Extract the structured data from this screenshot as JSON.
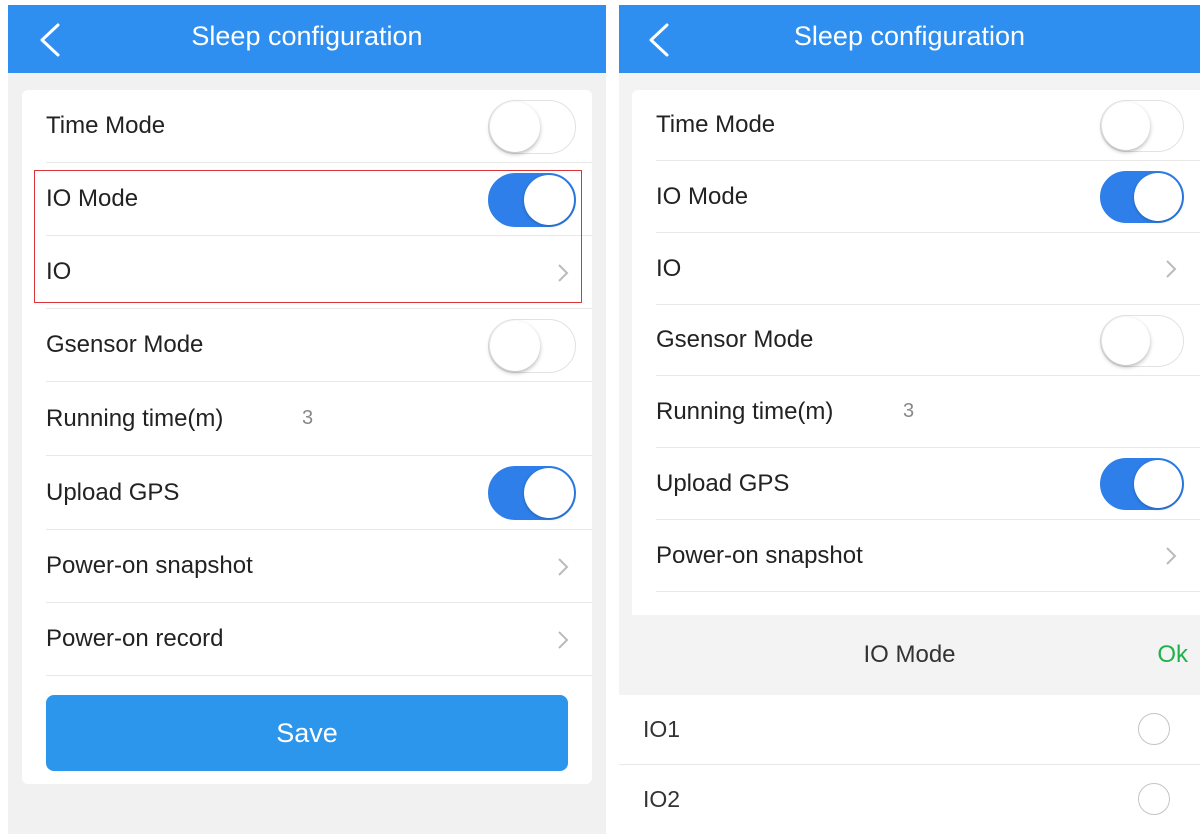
{
  "left_screen": {
    "header": {
      "title": "Sleep configuration"
    },
    "rows": [
      {
        "label": "Time Mode",
        "state": "off"
      },
      {
        "label": "IO Mode",
        "state": "on"
      },
      {
        "label": "IO"
      },
      {
        "label": "Gsensor Mode",
        "state": "off"
      },
      {
        "label": "Running time(m)",
        "value": "3"
      },
      {
        "label": "Upload GPS",
        "state": "on"
      },
      {
        "label": "Power-on snapshot"
      },
      {
        "label": "Power-on record"
      }
    ],
    "save_label": "Save",
    "highlight_color": "#d9343a"
  },
  "right_screen": {
    "header": {
      "title": "Sleep configuration"
    },
    "rows": [
      {
        "label": "Time Mode",
        "state": "off"
      },
      {
        "label": "IO Mode",
        "state": "on"
      },
      {
        "label": "IO"
      },
      {
        "label": "Gsensor Mode",
        "state": "off"
      },
      {
        "label": "Running time(m)",
        "value": "3"
      },
      {
        "label": "Upload GPS",
        "state": "on"
      },
      {
        "label": "Power-on snapshot"
      }
    ],
    "picker": {
      "title": "IO Mode",
      "ok_label": "Ok",
      "options": [
        {
          "label": "IO1",
          "selected": false
        },
        {
          "label": "IO2",
          "selected": false
        }
      ]
    }
  },
  "colors": {
    "header_blue": "#2e8ff0",
    "toggle_on": "#2e7fea",
    "save_button": "#2c96ec",
    "ok_green": "#22b04a"
  }
}
